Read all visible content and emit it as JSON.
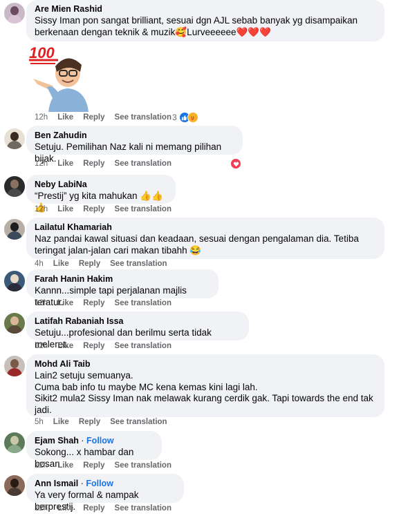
{
  "actions": {
    "like": "Like",
    "reply": "Reply",
    "see_translation": "See translation"
  },
  "follow_label": "Follow",
  "comments": [
    {
      "name": "Are Mien Rashid",
      "text": "Sissy Iman pon sangat brilliant, sesuai dgn AJL sebab banyak yg disampaikan\nberkenaan dengan teknik & muzik🥰Lurveeeeee❤️❤️❤️",
      "time": "12h",
      "reaction_count": "3",
      "sticker_text": "100"
    },
    {
      "name": "Ben Zahudin",
      "text": "Setuju. Pemilihan Naz kali ni memang pilihan bijak.",
      "time": "12h"
    },
    {
      "name": "Neby LabiNa",
      "text": "“Prestij” yg kita mahukan 👍👍👍",
      "time": "12h"
    },
    {
      "name": "Lailatul Khamariah",
      "text": "Naz pandai kawal situasi dan keadaan, sesuai dengan pengalaman dia. Tetiba\nteringat jalan-jalan cari makan tibahh 😂",
      "time": "4h"
    },
    {
      "name": "Farah Hanin Hakim",
      "text": "Kannn...simple tapi perjalanan majlis teratur.",
      "time": "12h"
    },
    {
      "name": "Latifah Rabaniah Issa",
      "text": "Setuju...profesional dan berilmu serta tidak meleret.",
      "time": "12h"
    },
    {
      "name": "Mohd Ali Taib",
      "text": "Lain2 setuju semuanya.\nCuma bab info tu maybe MC kena kemas kini lagi lah.\nSikit2 mula2 Sissy Iman nak melawak kurang cerdik gak. Tapi towards the end tak\njadi.",
      "time": "5h"
    },
    {
      "name": "Ejam Shah",
      "text": "Sokong... x hambar dan bosan",
      "time": "12h"
    },
    {
      "name": "Ann Ismail",
      "text": "Ya very formal & nampak berprestij.",
      "time": "12h"
    }
  ],
  "colors": {
    "bubble": "#f0f2f5",
    "secondary_text": "#65676b",
    "follow": "#1b74e4",
    "heart": "#f33e58"
  }
}
